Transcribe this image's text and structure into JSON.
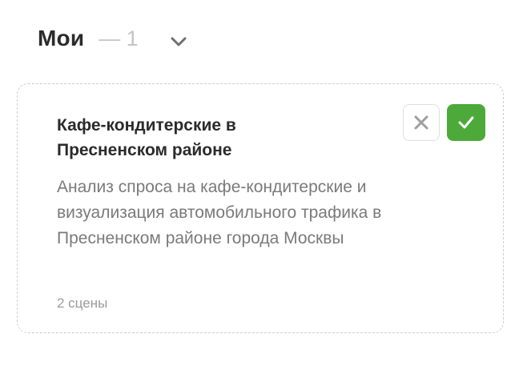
{
  "section": {
    "title": "Мои",
    "count_text": "— 1"
  },
  "card": {
    "title": "Кафе-кондитерские в Пресненском районе",
    "description": "Анализ спроса на кафе-кондитерские и визуализация автомобильного трафика в Пресненском районе города Москвы",
    "meta": "2 сцены"
  },
  "icons": {
    "chevron": "chevron-down-icon",
    "reject": "close-icon",
    "accept": "check-icon"
  },
  "colors": {
    "accent_green": "#4ea93b",
    "title_text": "#2b2b2b",
    "muted_text": "#7a7a7a",
    "count_text": "#c4c4c4"
  }
}
